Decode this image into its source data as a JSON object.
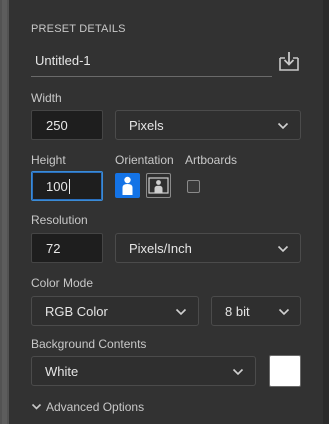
{
  "panel": {
    "section_title": "PRESET DETAILS",
    "preset_name": "Untitled-1",
    "save_preset_icon": "save-preset-icon"
  },
  "width": {
    "label": "Width",
    "value": "250",
    "unit": "Pixels"
  },
  "height": {
    "label": "Height",
    "value": "100"
  },
  "orientation": {
    "label": "Orientation",
    "selected": "portrait"
  },
  "artboards": {
    "label": "Artboards",
    "checked": false
  },
  "resolution": {
    "label": "Resolution",
    "value": "72",
    "unit": "Pixels/Inch"
  },
  "color_mode": {
    "label": "Color Mode",
    "mode": "RGB Color",
    "depth": "8 bit"
  },
  "background": {
    "label": "Background Contents",
    "value": "White",
    "swatch_color": "#ffffff"
  },
  "advanced": {
    "label": "Advanced Options"
  },
  "colors": {
    "panel_bg": "#323232",
    "accent": "#1473e6",
    "focus": "#3b8bd6"
  }
}
